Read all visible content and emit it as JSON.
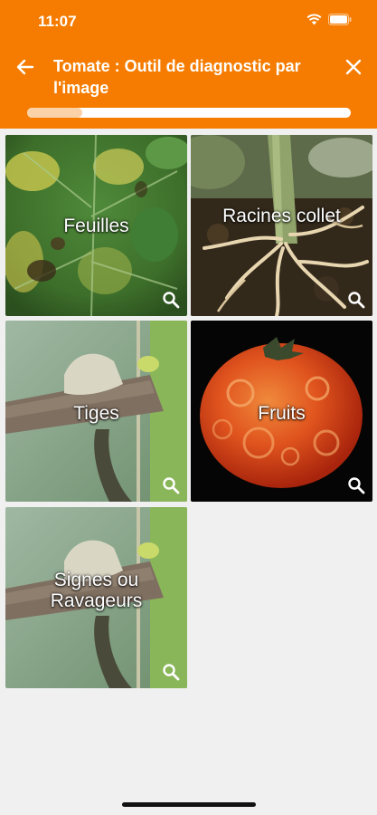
{
  "status": {
    "time": "11:07"
  },
  "header": {
    "title": "Tomate : Outil de diagnostic par l'image",
    "progress": 0.17,
    "icons": {
      "back": "arrow-left-icon",
      "close": "close-icon"
    }
  },
  "tiles": [
    {
      "label": "Feuilles",
      "icon": "magnify-icon"
    },
    {
      "label": "Racines collet",
      "icon": "magnify-icon"
    },
    {
      "label": "Tiges",
      "icon": "magnify-icon"
    },
    {
      "label": "Fruits",
      "icon": "magnify-icon"
    },
    {
      "label": "Signes ou Ravageurs",
      "icon": "magnify-icon"
    }
  ],
  "colors": {
    "header": "#f57c00",
    "background": "#f0f0f0"
  }
}
